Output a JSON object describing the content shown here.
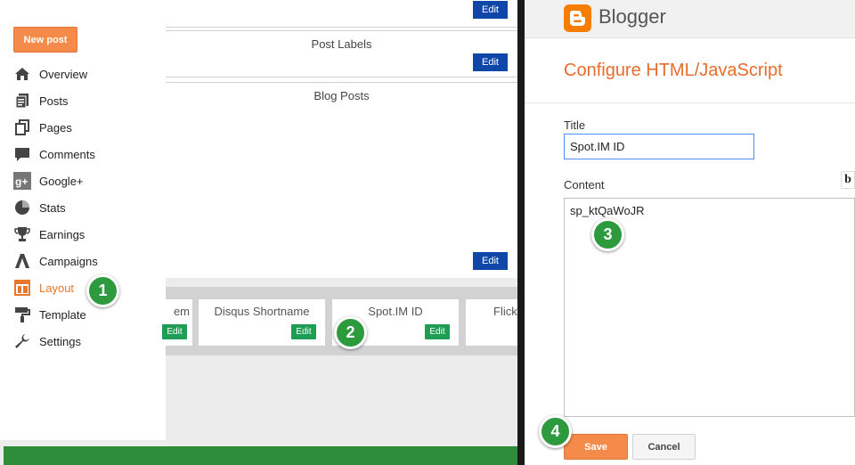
{
  "sidebar": {
    "new_post_label": "New post",
    "items": [
      {
        "label": "Overview",
        "icon": "home-icon"
      },
      {
        "label": "Posts",
        "icon": "posts-icon"
      },
      {
        "label": "Pages",
        "icon": "pages-icon"
      },
      {
        "label": "Comments",
        "icon": "comments-icon"
      },
      {
        "label": "Google+",
        "icon": "google-plus-icon"
      },
      {
        "label": "Stats",
        "icon": "stats-icon"
      },
      {
        "label": "Earnings",
        "icon": "trophy-icon"
      },
      {
        "label": "Campaigns",
        "icon": "campaigns-icon"
      },
      {
        "label": "Layout",
        "icon": "layout-icon",
        "active": true
      },
      {
        "label": "Template",
        "icon": "template-icon"
      },
      {
        "label": "Settings",
        "icon": "wrench-icon"
      }
    ]
  },
  "layout": {
    "edit_label": "Edit",
    "gadgets": [
      "Post Labels",
      "Blog Posts"
    ],
    "row_cards": [
      "em",
      "Disqus Shortname",
      "Spot.IM ID",
      "Flick"
    ]
  },
  "dialog": {
    "brand": "Blogger",
    "title": "Configure HTML/JavaScript",
    "title_label": "Title",
    "title_value": "Spot.IM ID",
    "content_label": "Content",
    "bold_button": "b",
    "content_value": "sp_ktQaWoJR",
    "save_label": "Save",
    "cancel_label": "Cancel"
  },
  "steps": [
    "1",
    "2",
    "3",
    "4"
  ],
  "colors": {
    "accent_orange": "#e86c2a",
    "button_orange": "#f58b4a",
    "edit_blue": "#0e47a8",
    "edit_green": "#1f9d55",
    "step_green": "#2e9a3e"
  }
}
